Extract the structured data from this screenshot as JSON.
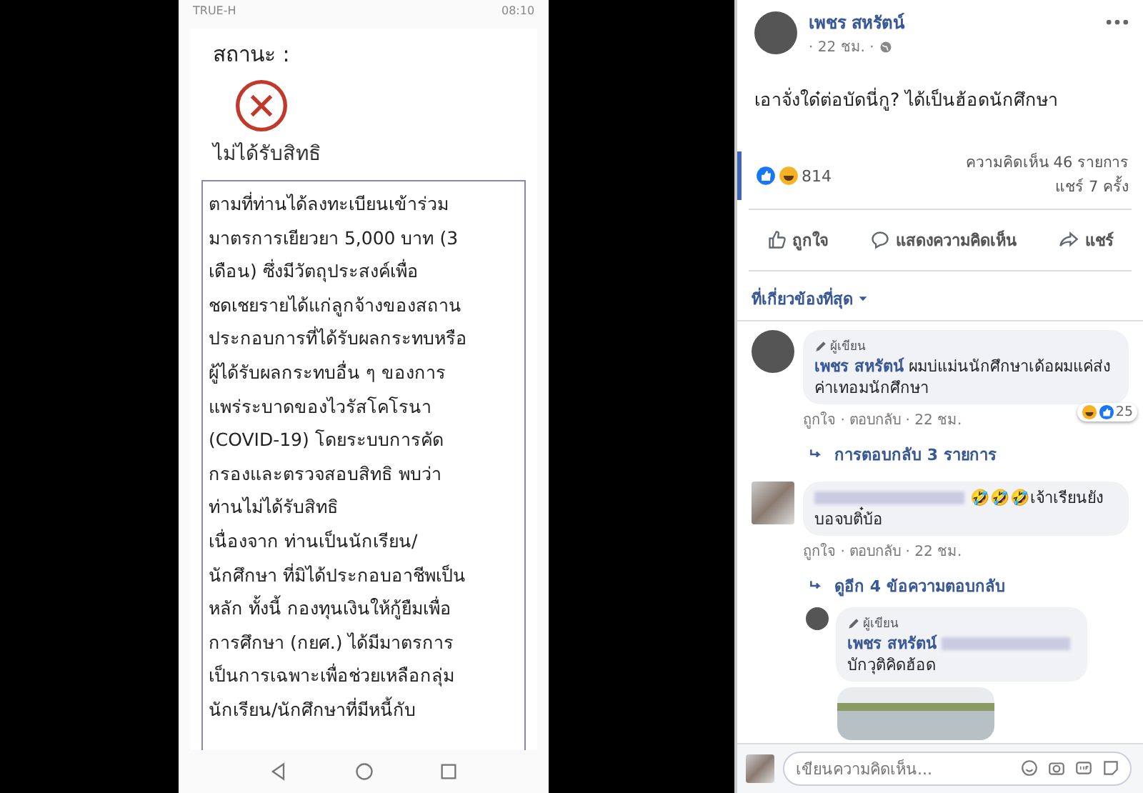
{
  "phone": {
    "status_bar": {
      "carrier": "TRUE-H",
      "time": "08:10"
    },
    "status_label": "สถานะ :",
    "status_result": "ไม่ได้รับสิทธิ",
    "message_lines": [
      "ตามที่ท่านได้ลงทะเบียนเข้าร่วม",
      "มาตรการเยียวยา 5,000 บาท (3",
      "เดือน) ซึ่งมีวัตถุประสงค์เพื่อ",
      "ชดเชยรายได้แก่ลูกจ้างของสถาน",
      "ประกอบการที่ได้รับผลกระทบหรือ",
      "ผู้ได้รับผลกระทบอื่น ๆ ของการ",
      "แพร่ระบาดของไวรัสโคโรนา",
      "(COVID-19) โดยระบบการคัด",
      "กรองและตรวจสอบสิทธิ พบว่า",
      "ท่านไม่ได้รับสิทธิ",
      "เนื่องจาก ท่านเป็นนักเรียน/",
      "นักศึกษา ที่มิได้ประกอบอาชีพเป็น",
      "หลัก ทั้งนี้ กองทุนเงินให้กู้ยืมเพื่อ",
      "การศึกษา (กยศ.) ได้มีมาตรการ",
      "เป็นการเฉพาะเพื่อช่วยเหลือกลุ่ม",
      "นักเรียน/นักศึกษาที่มีหนี้กับ"
    ]
  },
  "post": {
    "author": "เพชร สหรัตน์",
    "time": "· 22 ชม. ·",
    "text": "เอาจั่งใด๋ต่อบัดนี่กู? ได้เป็นฮ้อดนักศึกษา",
    "reaction_count": "814",
    "comments_count": "ความคิดเห็น 46 รายการ",
    "shares_count": "แชร์ 7 ครั้ง",
    "actions": [
      {
        "kind": "like",
        "label": "ถูกใจ"
      },
      {
        "kind": "comment",
        "label": "แสดงความคิดเห็น"
      },
      {
        "kind": "share",
        "label": "แชร์"
      }
    ],
    "sort": "ที่เกี่ยวข้องที่สุด"
  },
  "comments": [
    {
      "author_badge": "ผู้เขียน",
      "author": "เพชร สหรัตน์",
      "redacted_author": false,
      "text": "ผมบ่แม่นนักศึกษาเด้อผมแค่ส่งค่าเทอมนักศึกษา",
      "reactions": "25",
      "meta": "ถูกใจ · ตอบกลับ · 22 ชม.",
      "replies_link": "การตอบกลับ 3 รายการ"
    },
    {
      "redacted_author": true,
      "text": "🤣🤣🤣เจ้าเรียนยังบอจบติ๋บ้อ",
      "meta": "ถูกใจ · ตอบกลับ · 22 ชม.",
      "replies_link": "ดูอีก 4 ข้อความตอบกลับ"
    }
  ],
  "reply": {
    "author_badge": "ผู้เขียน",
    "author": "เพชร สหรัตน์",
    "text": "บักวุติคิดฮ้อด"
  },
  "composer": {
    "placeholder": "เขียนความคิดเห็น..."
  }
}
